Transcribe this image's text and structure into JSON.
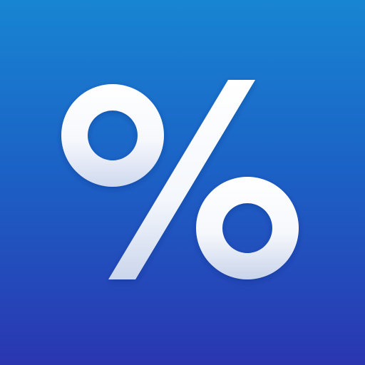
{
  "icon": {
    "name": "percent-icon",
    "glyph": "%",
    "colors": {
      "background_top": "#1885d2",
      "background_mid": "#1b63c6",
      "background_bottom": "#2a36b0",
      "glyph_top": "#ffffff",
      "glyph_bottom": "#c9d4ea"
    }
  }
}
